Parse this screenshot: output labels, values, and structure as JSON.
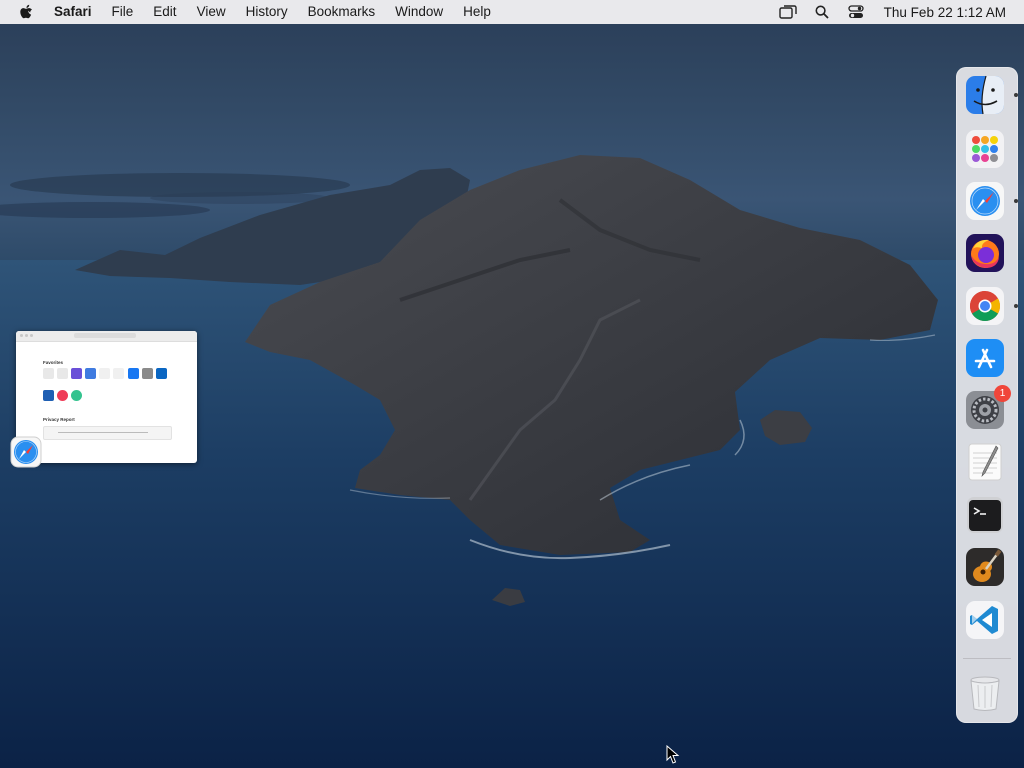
{
  "menubar": {
    "app_name": "Safari",
    "items": [
      "File",
      "Edit",
      "View",
      "History",
      "Bookmarks",
      "Window",
      "Help"
    ],
    "clock": "Thu Feb 22  1:12 AM",
    "status_icons": [
      "screen-mirroring-icon",
      "spotlight-search-icon",
      "control-center-icon"
    ]
  },
  "desktop": {
    "window_thumbnail": {
      "app": "Safari",
      "favorites_title": "Favorites",
      "privacy_title": "Privacy Report"
    }
  },
  "dock": {
    "items": [
      {
        "name": "Finder",
        "icon": "finder-icon",
        "running": true
      },
      {
        "name": "Launchpad",
        "icon": "launchpad-icon",
        "running": false
      },
      {
        "name": "Safari",
        "icon": "safari-icon",
        "running": true
      },
      {
        "name": "Firefox",
        "icon": "firefox-icon",
        "running": false
      },
      {
        "name": "Google Chrome",
        "icon": "chrome-icon",
        "running": true
      },
      {
        "name": "App Store",
        "icon": "app-store-icon",
        "running": false
      },
      {
        "name": "System Preferences",
        "icon": "system-preferences-icon",
        "running": false,
        "badge": "1"
      },
      {
        "name": "TextEdit",
        "icon": "textedit-icon",
        "running": false
      },
      {
        "name": "Terminal",
        "icon": "terminal-icon",
        "running": false
      },
      {
        "name": "GarageBand",
        "icon": "garageband-icon",
        "running": false
      },
      {
        "name": "Visual Studio Code",
        "icon": "vscode-icon",
        "running": false
      },
      {
        "name": "Trash",
        "icon": "trash-icon",
        "running": false
      }
    ]
  }
}
